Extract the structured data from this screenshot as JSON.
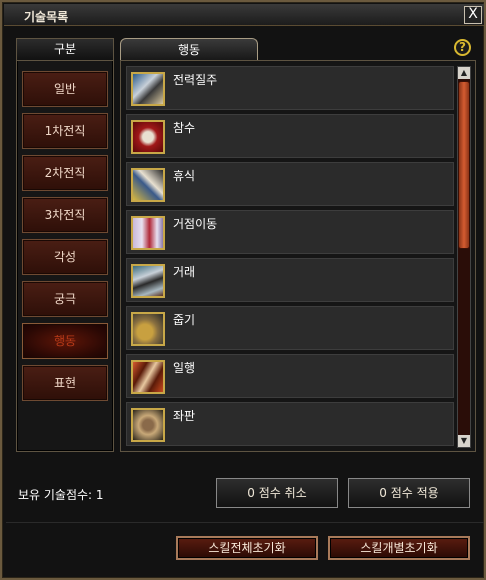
{
  "window": {
    "title": "기술목록",
    "close_label": "X"
  },
  "left": {
    "header": "구분",
    "categories": [
      {
        "label": "일반"
      },
      {
        "label": "1차전직"
      },
      {
        "label": "2차전직"
      },
      {
        "label": "3차전직"
      },
      {
        "label": "각성"
      },
      {
        "label": "궁극"
      },
      {
        "label": "행동",
        "active": true
      },
      {
        "label": "표현"
      }
    ]
  },
  "tab": {
    "label": "행동"
  },
  "help": {
    "label": "?"
  },
  "skills": [
    {
      "name": "전력질주",
      "icon": "sprint-icon"
    },
    {
      "name": "참수",
      "icon": "behead-icon"
    },
    {
      "name": "휴식",
      "icon": "rest-icon"
    },
    {
      "name": "거점이동",
      "icon": "base-move-icon"
    },
    {
      "name": "거래",
      "icon": "trade-icon"
    },
    {
      "name": "줍기",
      "icon": "pickup-icon"
    },
    {
      "name": "일행",
      "icon": "party-icon"
    },
    {
      "name": "좌판",
      "icon": "stall-icon"
    }
  ],
  "footer": {
    "points_text": "보유 기술점수: 1",
    "cancel_label": "0 점수 취소",
    "apply_label": "0 점수 적용",
    "reset_all_label": "스킬전체초기화",
    "reset_each_label": "스킬개별초기화"
  },
  "scroll": {
    "up": "▲",
    "down": "▼",
    "position": 0.0,
    "visible_fraction": 0.45
  }
}
